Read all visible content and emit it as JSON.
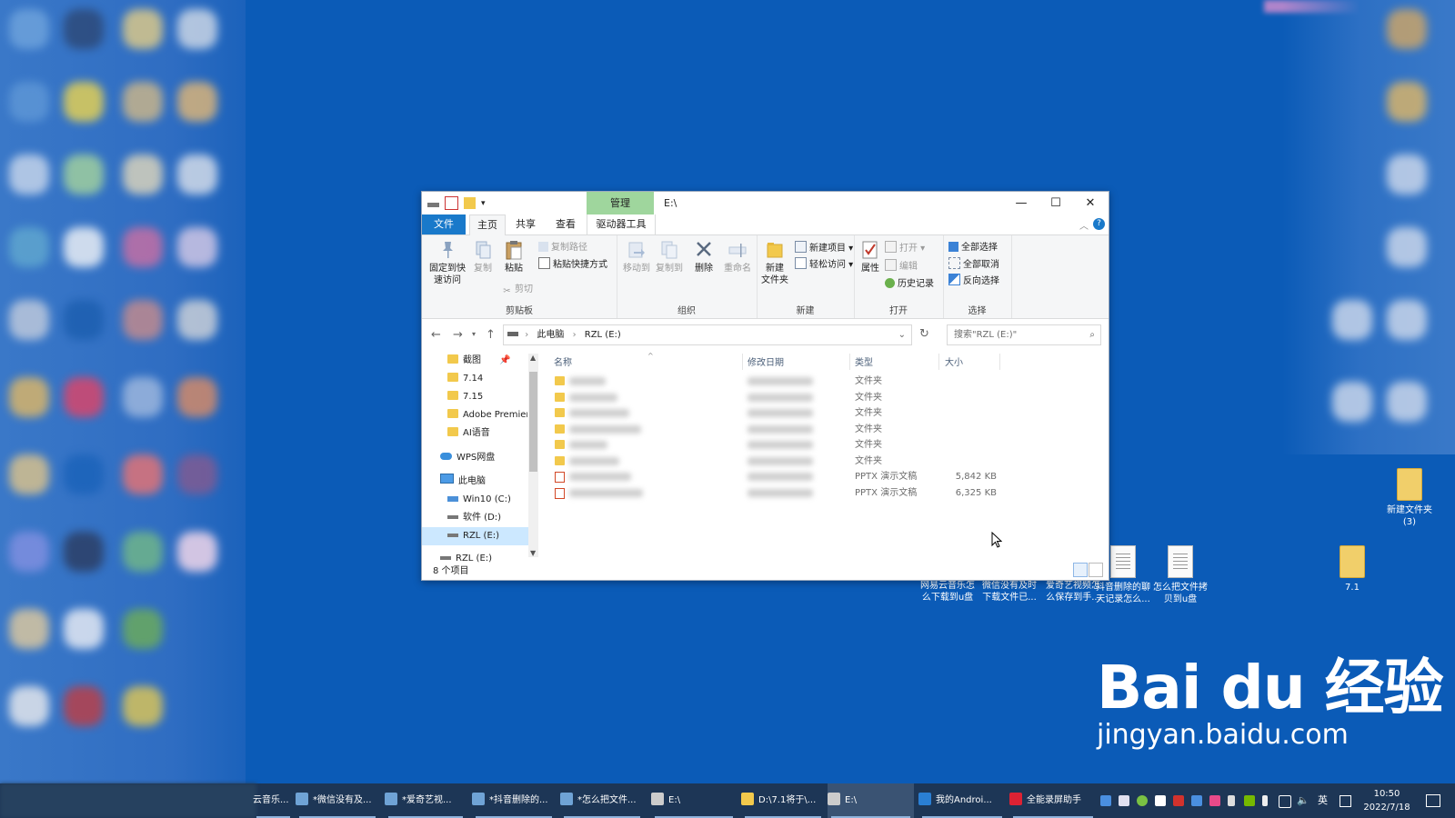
{
  "window": {
    "manage_tab": "管理",
    "title": "E:\\",
    "min": "—",
    "max": "☐",
    "close": "✕",
    "tabs": {
      "file": "文件",
      "home": "主页",
      "share": "共享",
      "view": "查看",
      "drive_tools": "驱动器工具"
    }
  },
  "ribbon": {
    "clipboard": {
      "label": "剪贴板",
      "pin": "固定到快\n速访问",
      "pin_a": "固定到快",
      "pin_b": "速访问",
      "copy": "复制",
      "paste": "粘贴",
      "copy_path": "复制路径",
      "paste_shortcut": "粘贴快捷方式",
      "cut": "剪切"
    },
    "organize": {
      "label": "组织",
      "move_to": "移动到",
      "copy_to": "复制到",
      "delete": "删除",
      "rename": "重命名"
    },
    "new": {
      "label": "新建",
      "new_folder_a": "新建",
      "new_folder_b": "文件夹",
      "new_item": "新建项目 ▾",
      "easy_access": "轻松访问 ▾"
    },
    "open": {
      "label": "打开",
      "properties": "属性",
      "open": "打开 ▾",
      "edit": "编辑",
      "history": "历史记录"
    },
    "select": {
      "label": "选择",
      "select_all": "全部选择",
      "select_none": "全部取消",
      "invert": "反向选择"
    }
  },
  "address": {
    "crumbs": [
      "此电脑",
      "RZL (E:)"
    ],
    "search_placeholder": "搜索\"RZL (E:)\""
  },
  "nav_pane": {
    "items": [
      "截图",
      "7.14",
      "7.15",
      "Adobe Premier",
      "AI语音",
      "WPS网盘",
      "此电脑",
      "Win10 (C:)",
      "软件 (D:)",
      "RZL (E:)",
      "RZL (E:)"
    ]
  },
  "list": {
    "headers": {
      "name": "名称",
      "date": "修改日期",
      "type": "类型",
      "size": "大小"
    },
    "rows": [
      {
        "type": "文件夹",
        "size": "",
        "icon": "folder"
      },
      {
        "type": "文件夹",
        "size": "",
        "icon": "folder"
      },
      {
        "type": "文件夹",
        "size": "",
        "icon": "folder"
      },
      {
        "type": "文件夹",
        "size": "",
        "icon": "folder"
      },
      {
        "type": "文件夹",
        "size": "",
        "icon": "folder"
      },
      {
        "type": "文件夹",
        "size": "",
        "icon": "folder"
      },
      {
        "type": "PPTX 演示文稿",
        "size": "5,842 KB",
        "icon": "pptx"
      },
      {
        "type": "PPTX 演示文稿",
        "size": "6,325 KB",
        "icon": "pptx"
      }
    ]
  },
  "status": {
    "count": "8 个项目"
  },
  "desktop": {
    "files": [
      {
        "l1": "网易云音乐怎",
        "l2": "么下载到u盘"
      },
      {
        "l1": "微信没有及时",
        "l2": "下载文件已..."
      },
      {
        "l1": "爱奇艺视频怎",
        "l2": "么保存到手..."
      },
      {
        "l1": "抖音删除的聊",
        "l2": "天记录怎么..."
      },
      {
        "l1": "怎么把文件拷",
        "l2": "贝到u盘"
      }
    ],
    "folder_71": "7.1",
    "new_folder_a": "新建文件夹",
    "new_folder_b": "(3)"
  },
  "watermark": {
    "brand": "Bai du 经验",
    "url": "jingyan.baidu.com"
  },
  "taskbar": {
    "items": [
      "云音乐...",
      "*微信没有及...",
      "*爱奇艺视...",
      "*抖音删除的...",
      "*怎么把文件...",
      "E:\\",
      "D:\\7.1将于\\...",
      "E:\\",
      "我的Androi...",
      "全能录屏助手"
    ],
    "lang": "英",
    "time": "10:50",
    "date": "2022/7/18"
  },
  "colors": {
    "accent": "#1979ca",
    "manage_tab": "#9fd69d",
    "desktop": "#0b5bb7",
    "taskbar": "#1d3656"
  }
}
